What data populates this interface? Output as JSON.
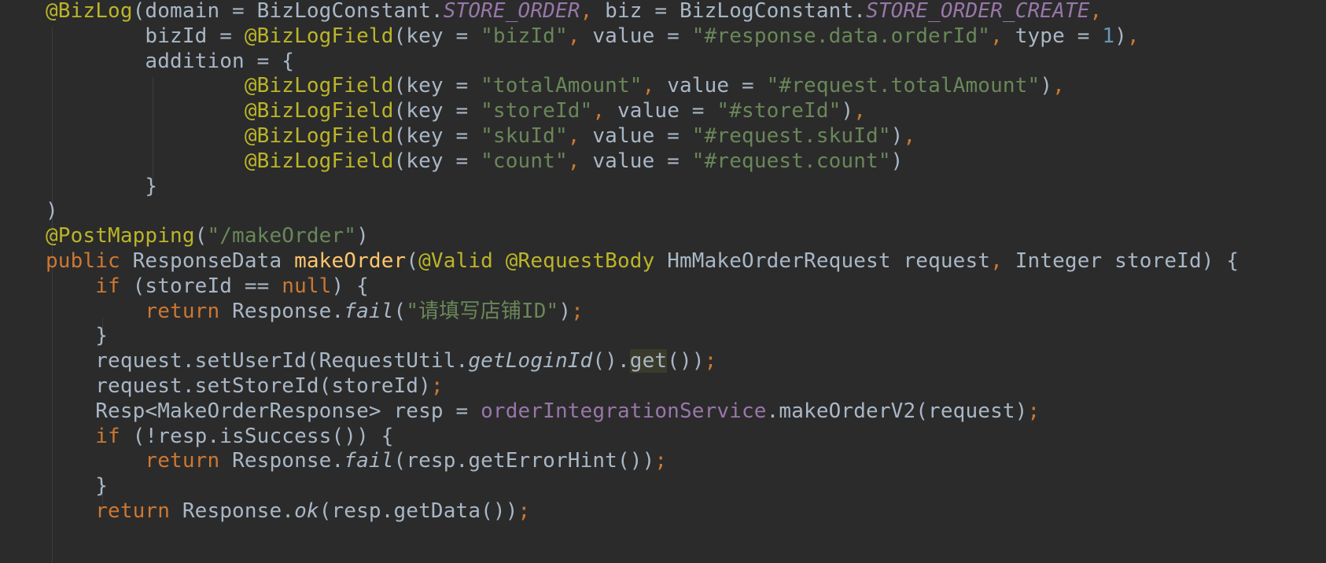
{
  "code_lines": [
    [
      [
        "ann",
        "@BizLog"
      ],
      [
        "plain",
        "(domain = BizLogConstant."
      ],
      [
        "const",
        "STORE_ORDER"
      ],
      [
        "punct",
        ","
      ],
      [
        "plain",
        " biz = BizLogConstant."
      ],
      [
        "const",
        "STORE_ORDER_CREATE"
      ],
      [
        "punct",
        ","
      ]
    ],
    [
      [
        "plain",
        "        bizId = "
      ],
      [
        "ann",
        "@BizLogField"
      ],
      [
        "plain",
        "(key = "
      ],
      [
        "str",
        "\"bizId\""
      ],
      [
        "punct",
        ","
      ],
      [
        "plain",
        " value = "
      ],
      [
        "str",
        "\"#response.data.orderId\""
      ],
      [
        "punct",
        ","
      ],
      [
        "plain",
        " type = "
      ],
      [
        "num",
        "1"
      ],
      [
        "plain",
        ")"
      ],
      [
        "punct",
        ","
      ]
    ],
    [
      [
        "plain",
        "        addition = {"
      ]
    ],
    [
      [
        "plain",
        "                "
      ],
      [
        "ann",
        "@BizLogField"
      ],
      [
        "plain",
        "(key = "
      ],
      [
        "str",
        "\"totalAmount\""
      ],
      [
        "punct",
        ","
      ],
      [
        "plain",
        " value = "
      ],
      [
        "str",
        "\"#request.totalAmount\""
      ],
      [
        "plain",
        ")"
      ],
      [
        "punct",
        ","
      ]
    ],
    [
      [
        "plain",
        "                "
      ],
      [
        "ann",
        "@BizLogField"
      ],
      [
        "plain",
        "(key = "
      ],
      [
        "str",
        "\"storeId\""
      ],
      [
        "punct",
        ","
      ],
      [
        "plain",
        " value = "
      ],
      [
        "str",
        "\"#storeId\""
      ],
      [
        "plain",
        ")"
      ],
      [
        "punct",
        ","
      ]
    ],
    [
      [
        "plain",
        "                "
      ],
      [
        "ann",
        "@BizLogField"
      ],
      [
        "plain",
        "(key = "
      ],
      [
        "str",
        "\"skuId\""
      ],
      [
        "punct",
        ","
      ],
      [
        "plain",
        " value = "
      ],
      [
        "str",
        "\"#request.skuId\""
      ],
      [
        "plain",
        ")"
      ],
      [
        "punct",
        ","
      ]
    ],
    [
      [
        "plain",
        "                "
      ],
      [
        "ann",
        "@BizLogField"
      ],
      [
        "plain",
        "(key = "
      ],
      [
        "str",
        "\"count\""
      ],
      [
        "punct",
        ","
      ],
      [
        "plain",
        " value = "
      ],
      [
        "str",
        "\"#request.count\""
      ],
      [
        "plain",
        ")"
      ]
    ],
    [
      [
        "plain",
        "        }"
      ]
    ],
    [
      [
        "plain",
        ")"
      ]
    ],
    [
      [
        "ann",
        "@PostMapping"
      ],
      [
        "plain",
        "("
      ],
      [
        "str",
        "\"/makeOrder\""
      ],
      [
        "plain",
        ")"
      ]
    ],
    [
      [
        "kw",
        "public "
      ],
      [
        "plain",
        "ResponseData "
      ],
      [
        "method",
        "makeOrder"
      ],
      [
        "plain",
        "("
      ],
      [
        "ann",
        "@Valid @RequestBody "
      ],
      [
        "plain",
        "HmMakeOrderRequest request"
      ],
      [
        "punct",
        ","
      ],
      [
        "plain",
        " Integer storeId) {"
      ]
    ],
    [
      [
        "kw",
        "    if "
      ],
      [
        "plain",
        "(storeId == "
      ],
      [
        "kw",
        "null"
      ],
      [
        "plain",
        ") {"
      ]
    ],
    [
      [
        "kw",
        "        return "
      ],
      [
        "plain",
        "Response."
      ],
      [
        "static",
        "fail"
      ],
      [
        "plain",
        "("
      ],
      [
        "str",
        "\""
      ],
      [
        "strcn",
        "请填写店铺"
      ],
      [
        "str",
        "ID\""
      ],
      [
        "plain",
        ")"
      ],
      [
        "punct",
        ";"
      ]
    ],
    [
      [
        "plain",
        "    }"
      ]
    ],
    [
      [
        "plain",
        "    request.setUserId(RequestUtil."
      ],
      [
        "static",
        "getLoginId"
      ],
      [
        "plain",
        "()."
      ],
      [
        "hl",
        "get"
      ],
      [
        "plain",
        "())"
      ],
      [
        "punct",
        ";"
      ]
    ],
    [
      [
        "plain",
        "    request.setStoreId(storeId)"
      ],
      [
        "punct",
        ";"
      ]
    ],
    [
      [
        "plain",
        "    Resp<MakeOrderResponse> resp = "
      ],
      [
        "field",
        "orderIntegrationService"
      ],
      [
        "plain",
        ".makeOrderV2(request)"
      ],
      [
        "punct",
        ";"
      ]
    ],
    [
      [
        "kw",
        "    if "
      ],
      [
        "plain",
        "(!resp.isSuccess()) {"
      ]
    ],
    [
      [
        "kw",
        "        return "
      ],
      [
        "plain",
        "Response."
      ],
      [
        "static",
        "fail"
      ],
      [
        "plain",
        "(resp.getErrorHint())"
      ],
      [
        "punct",
        ";"
      ]
    ],
    [
      [
        "plain",
        "    }"
      ]
    ],
    [
      [
        "kw",
        "    return "
      ],
      [
        "plain",
        "Response."
      ],
      [
        "static",
        "ok"
      ],
      [
        "plain",
        "(resp.getData())"
      ],
      [
        "punct",
        ";"
      ]
    ]
  ]
}
